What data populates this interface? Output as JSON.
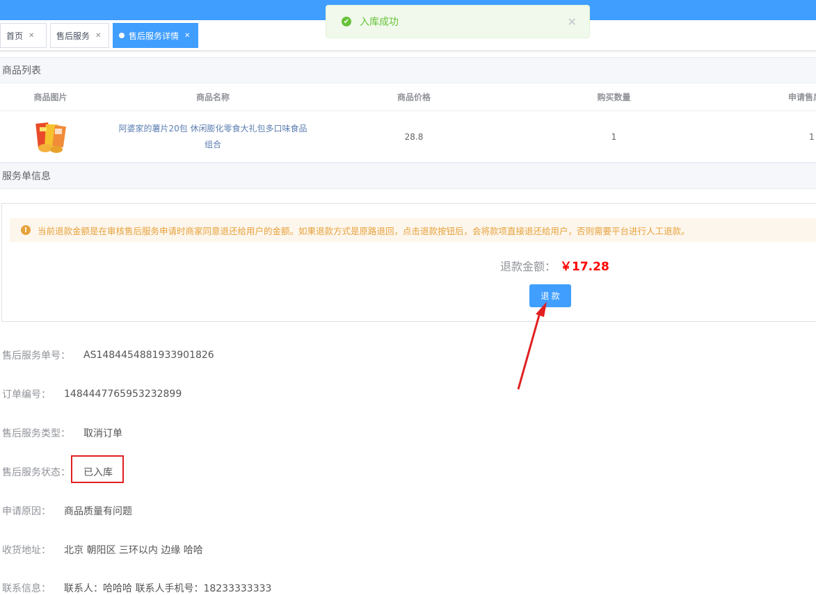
{
  "tabs": [
    {
      "label": "首页",
      "active": false
    },
    {
      "label": "售后服务",
      "active": false
    },
    {
      "label": "售后服务详情",
      "active": true
    }
  ],
  "toast": {
    "message": "入库成功"
  },
  "product_section": {
    "title": "商品列表",
    "columns": [
      "商品图片",
      "商品名称",
      "商品价格",
      "购买数量",
      "申请售后"
    ],
    "rows": [
      {
        "name": "阿婆家的薯片20包 休闲膨化零食大礼包多口味食品组合",
        "price": "28.8",
        "quantity": "1",
        "apply_quantity": "1"
      }
    ]
  },
  "service_section": {
    "title": "服务单信息",
    "alert": "当前退款金额是在审核售后服务申请时商家同意退还给用户的金额。如果退款方式是原路退回，点击退款按钮后，会将款项直接退还给用户，否则需要平台进行人工退款。",
    "amount_label": "退款金额：",
    "amount_value": "￥17.28",
    "refund_button": "退 款"
  },
  "details": [
    {
      "label": "售后服务单号：",
      "value": "AS1484454881933901826"
    },
    {
      "label": "订单编号：",
      "value": "1484447765953232899"
    },
    {
      "label": "售后服务类型：",
      "value": "取消订单"
    },
    {
      "label": "售后服务状态：",
      "value": "已入库"
    },
    {
      "label": "申请原因：",
      "value": "商品质量有问题"
    },
    {
      "label": "收货地址：",
      "value": "北京 朝阳区 三环以内 边缘 哈哈"
    },
    {
      "label": "联系信息：",
      "value": "联系人：哈哈哈   联系人手机号：18233333333"
    }
  ],
  "colors": {
    "primary": "#409eff",
    "success": "#67c23a",
    "warning": "#e6a23c",
    "danger": "#ff0000",
    "annotation": "#e02020"
  }
}
